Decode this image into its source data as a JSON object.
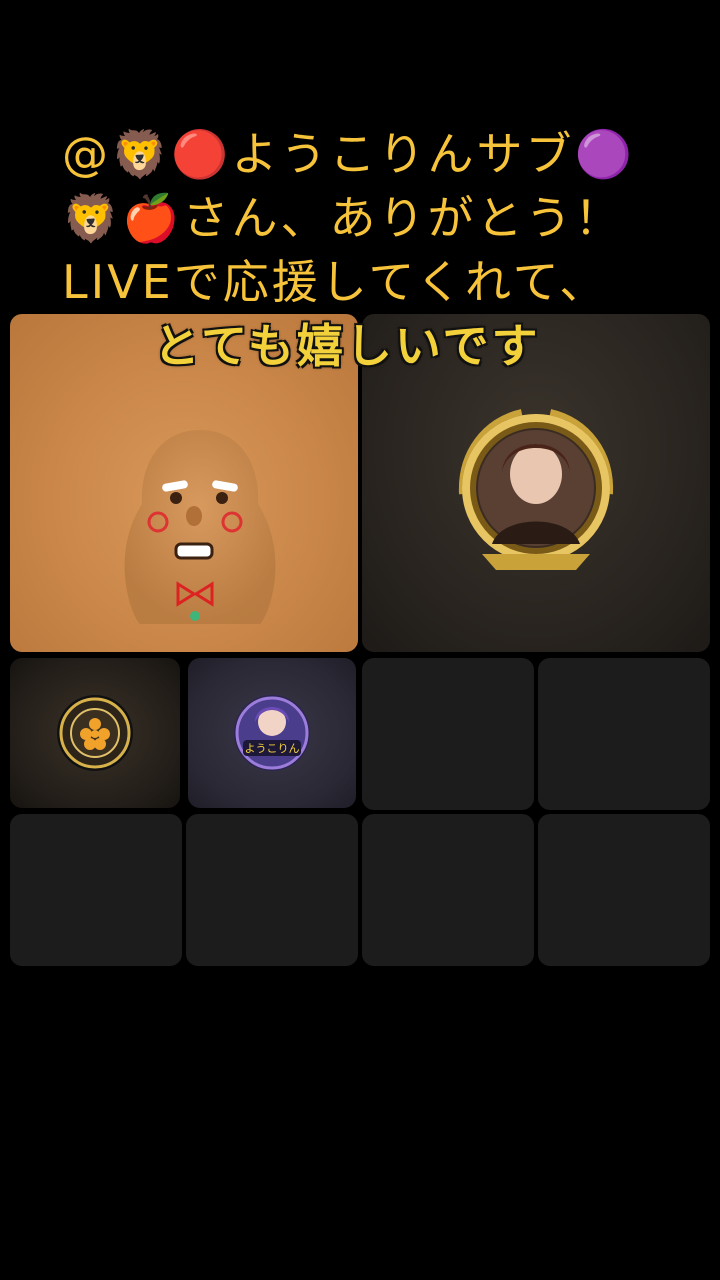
{
  "caption": {
    "lines": [
      "@🦁🔴ようこりんサブ🟣",
      "🦁🍎さん、ありがとう！",
      "LIVEで応援してくれて、",
      "とても嬉しいです"
    ]
  },
  "tiles": [
    {
      "id": "tile-1",
      "avatar": "gingerbread-avatar"
    },
    {
      "id": "tile-2",
      "avatar": "gold-frame-portrait-avatar"
    },
    {
      "id": "tile-3",
      "avatar": "dragon-ball-badge-avatar"
    },
    {
      "id": "tile-4",
      "avatar": "anime-girl-badge-avatar",
      "badge_text": "ようこりん"
    },
    {
      "id": "tile-5",
      "avatar": ""
    },
    {
      "id": "tile-6",
      "avatar": ""
    },
    {
      "id": "tile-7",
      "avatar": ""
    },
    {
      "id": "tile-8",
      "avatar": ""
    },
    {
      "id": "tile-9",
      "avatar": ""
    },
    {
      "id": "tile-10",
      "avatar": ""
    }
  ],
  "colors": {
    "background": "#000000",
    "caption_text": "#f6c33a",
    "empty_tile": "#1c1c1c",
    "gold": "#d4a836"
  }
}
